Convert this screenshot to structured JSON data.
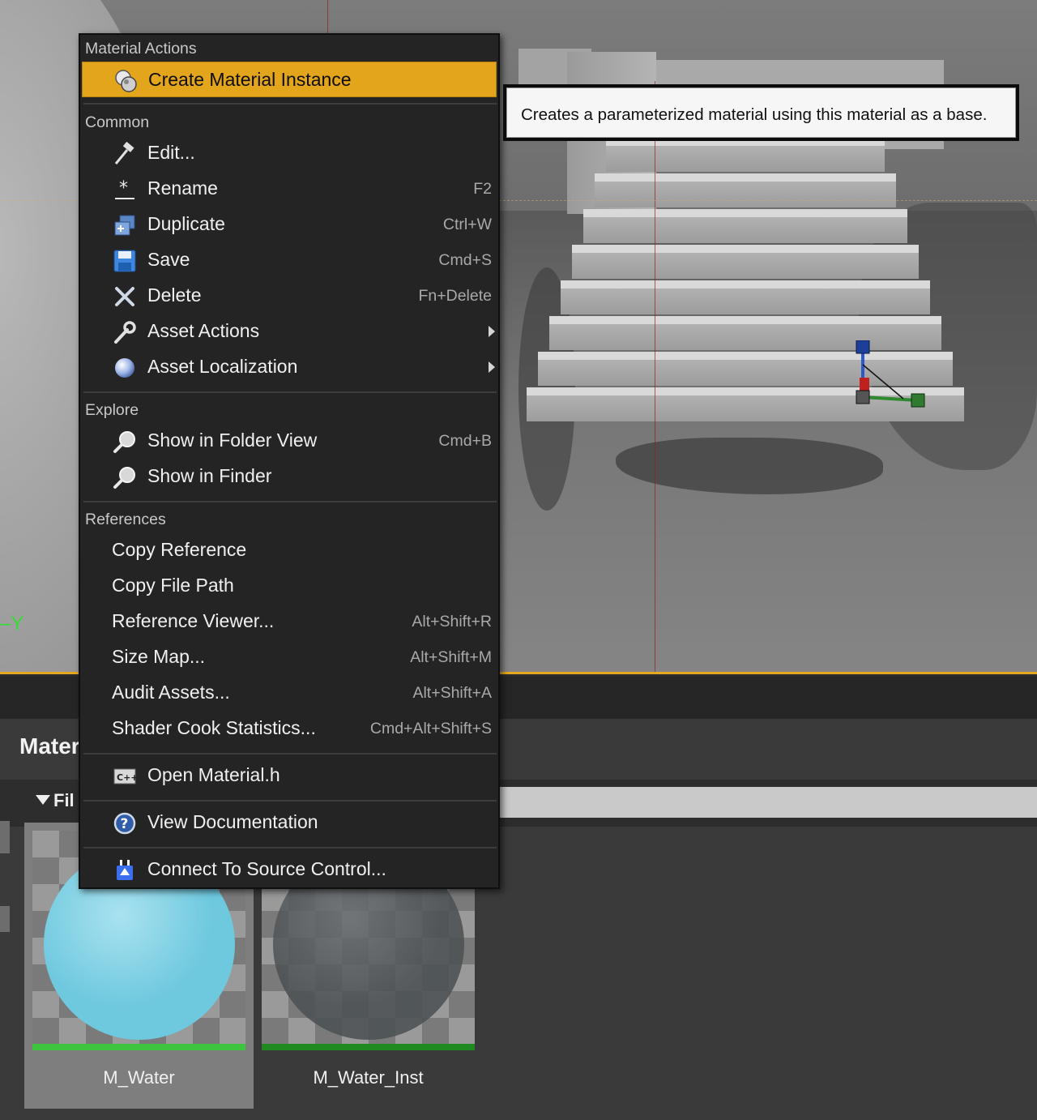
{
  "viewport": {
    "axis_label": "Y"
  },
  "context_menu": {
    "sections": [
      {
        "label": "Material Actions"
      },
      {
        "label": "Common"
      },
      {
        "label": "Explore"
      },
      {
        "label": "References"
      }
    ],
    "items": [
      {
        "label": "Create Material Instance",
        "shortcut": "",
        "icon": "material-instance-icon",
        "highlighted": true
      },
      {
        "label": "Edit...",
        "shortcut": "",
        "icon": "edit-hammer-icon"
      },
      {
        "label": "Rename",
        "shortcut": "F2",
        "icon": "rename-icon"
      },
      {
        "label": "Duplicate",
        "shortcut": "Ctrl+W",
        "icon": "duplicate-icon"
      },
      {
        "label": "Save",
        "shortcut": "Cmd+S",
        "icon": "save-icon"
      },
      {
        "label": "Delete",
        "shortcut": "Fn+Delete",
        "icon": "delete-icon"
      },
      {
        "label": "Asset Actions",
        "shortcut": "",
        "icon": "wrench-icon",
        "submenu": true
      },
      {
        "label": "Asset Localization",
        "shortcut": "",
        "icon": "globe-icon",
        "submenu": true
      },
      {
        "label": "Show in Folder View",
        "shortcut": "Cmd+B",
        "icon": "magnifier-icon"
      },
      {
        "label": "Show in Finder",
        "shortcut": "",
        "icon": "magnifier-icon"
      },
      {
        "label": "Copy Reference",
        "shortcut": ""
      },
      {
        "label": "Copy File Path",
        "shortcut": ""
      },
      {
        "label": "Reference Viewer...",
        "shortcut": "Alt+Shift+R"
      },
      {
        "label": "Size Map...",
        "shortcut": "Alt+Shift+M"
      },
      {
        "label": "Audit Assets...",
        "shortcut": "Alt+Shift+A"
      },
      {
        "label": "Shader Cook Statistics...",
        "shortcut": "Cmd+Alt+Shift+S"
      },
      {
        "label": "Open Material.h",
        "shortcut": "",
        "icon": "cpp-file-icon"
      },
      {
        "label": "View Documentation",
        "shortcut": "",
        "icon": "help-icon"
      },
      {
        "label": "Connect To Source Control...",
        "shortcut": "",
        "icon": "source-control-plug-icon"
      }
    ]
  },
  "tooltip": {
    "text": "Creates a parameterized material using this material as a base."
  },
  "content_browser": {
    "title": "Mater",
    "filter_label": "Fil",
    "assets": [
      {
        "name": "M_Water",
        "selected": true,
        "sphere_color": "#6ec8de",
        "bar_color": "#3fc43f"
      },
      {
        "name": "M_Water_Inst",
        "selected": false,
        "sphere_color": "#4a4f52",
        "bar_color": "#1f8a1f"
      }
    ]
  },
  "colors": {
    "highlight": "#e3a51b",
    "viewport_border": "#e5a821",
    "menu_background": "#242424"
  }
}
